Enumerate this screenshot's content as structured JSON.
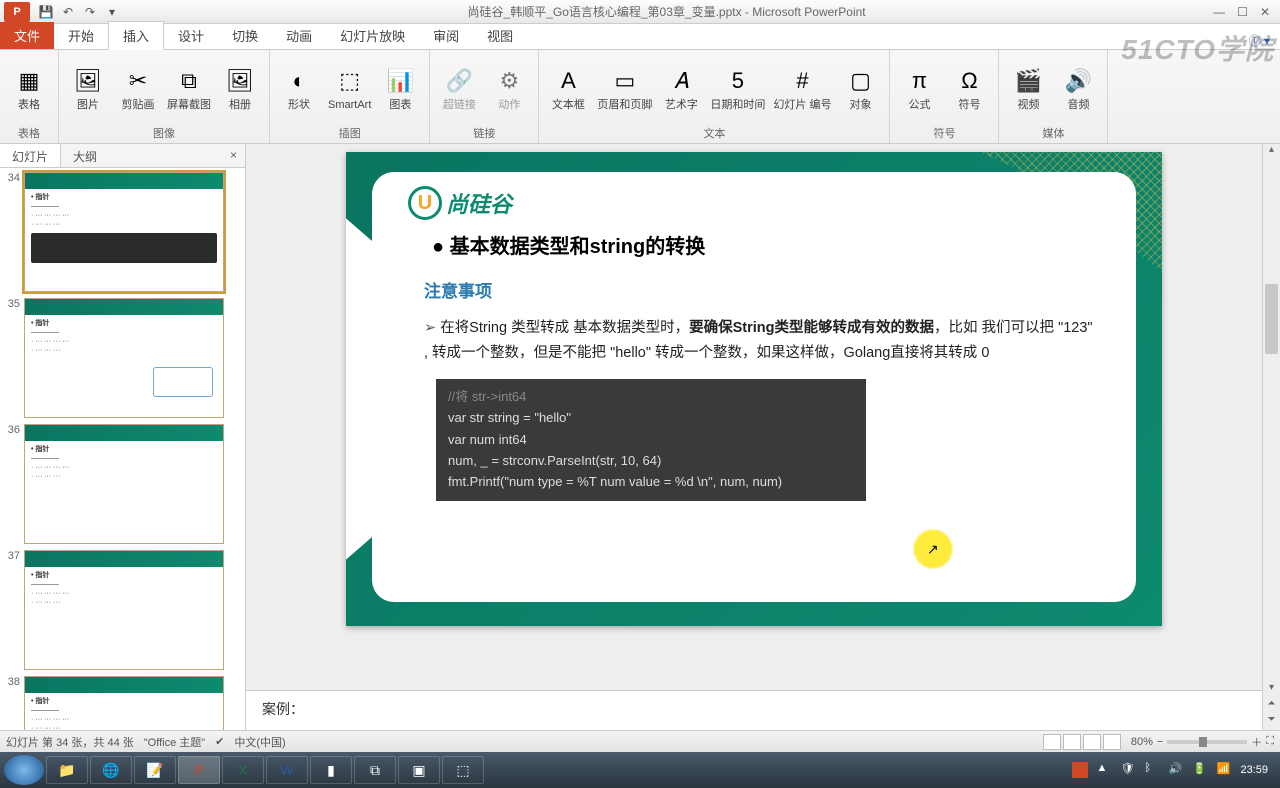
{
  "titlebar": {
    "app_badge": "P",
    "title": "尚硅谷_韩顺平_Go语言核心编程_第03章_变量.pptx - Microsoft PowerPoint"
  },
  "watermark": "51CTO学院",
  "tabs": {
    "file": "文件",
    "items": [
      "开始",
      "插入",
      "设计",
      "切换",
      "动画",
      "幻灯片放映",
      "审阅",
      "视图"
    ],
    "active_index": 1
  },
  "ribbon": {
    "groups": [
      {
        "label": "表格",
        "items": [
          {
            "icon": "▦",
            "label": "表格"
          }
        ]
      },
      {
        "label": "图像",
        "items": [
          {
            "icon": "🖼",
            "label": "图片"
          },
          {
            "icon": "✂",
            "label": "剪贴画"
          },
          {
            "icon": "⧉",
            "label": "屏幕截图"
          },
          {
            "icon": "🖼",
            "label": "相册"
          }
        ]
      },
      {
        "label": "插图",
        "items": [
          {
            "icon": "◐",
            "label": "形状"
          },
          {
            "icon": "⬚",
            "label": "SmartArt"
          },
          {
            "icon": "📊",
            "label": "图表"
          }
        ]
      },
      {
        "label": "链接",
        "items": [
          {
            "icon": "🔗",
            "label": "超链接",
            "disabled": true
          },
          {
            "icon": "⚙",
            "label": "动作",
            "disabled": true
          }
        ]
      },
      {
        "label": "文本",
        "items": [
          {
            "icon": "A",
            "label": "文本框"
          },
          {
            "icon": "▭",
            "label": "页眉和页脚"
          },
          {
            "icon": "𝐴",
            "label": "艺术字"
          },
          {
            "icon": "5",
            "label": "日期和时间"
          },
          {
            "icon": "#",
            "label": "幻灯片\n编号"
          },
          {
            "icon": "▢",
            "label": "对象"
          }
        ]
      },
      {
        "label": "符号",
        "items": [
          {
            "icon": "π",
            "label": "公式"
          },
          {
            "icon": "Ω",
            "label": "符号"
          }
        ]
      },
      {
        "label": "媒体",
        "items": [
          {
            "icon": "🎬",
            "label": "视频"
          },
          {
            "icon": "🔊",
            "label": "音频"
          }
        ]
      }
    ]
  },
  "sidepanel": {
    "tab_slides": "幻灯片",
    "tab_outline": "大纲",
    "thumbs": [
      {
        "num": "34",
        "selected": true
      },
      {
        "num": "35"
      },
      {
        "num": "36"
      },
      {
        "num": "37"
      },
      {
        "num": "38"
      }
    ]
  },
  "slide": {
    "logo_text": "尚硅谷",
    "heading": "基本数据类型和string的转换",
    "section": "注意事项",
    "para_pre": "在将String 类型转成 基本数据类型时，",
    "para_bold": "要确保String类型能够转成有效的数据",
    "para_post": "，比如 我们可以把 \"123\" , 转成一个整数，但是不能把 \"hello\" 转成一个整数，如果这样做，Golang直接将其转成 0",
    "code_line1": "//将 str->int64",
    "code_line2": "var str string = \"hello\"",
    "code_line3": "var num int64",
    "code_line4": "num, _ = strconv.ParseInt(str, 10, 64)",
    "code_line5": "fmt.Printf(\"num type = %T num value = %d \\n\", num, num)"
  },
  "notes": {
    "label": "案例："
  },
  "statusbar": {
    "slide_info": "幻灯片 第 34 张，共 44 张",
    "theme": "\"Office 主题\"",
    "lang": "中文(中国)",
    "zoom": "80%"
  },
  "taskbar": {
    "time": "23:59"
  }
}
